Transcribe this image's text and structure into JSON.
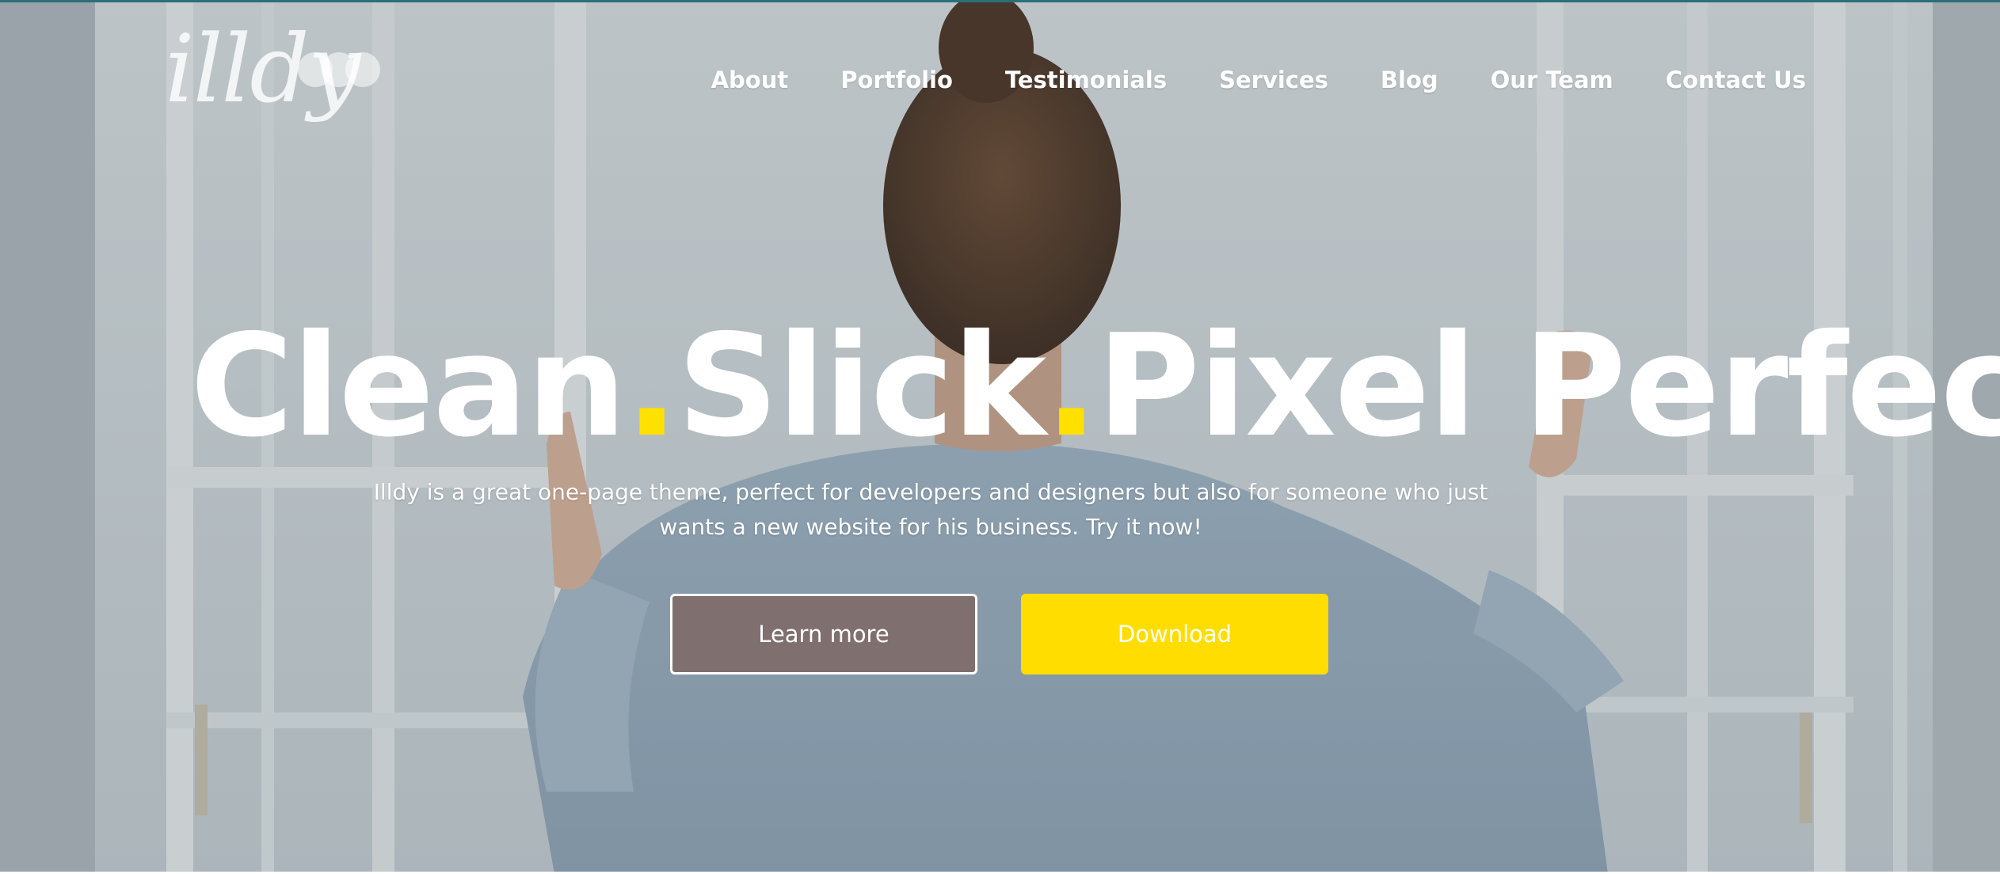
{
  "colors": {
    "accent": "#ffdd00",
    "learn_more_bg": "#7f6f6f",
    "text": "#ffffff",
    "top_stripe": "#2b6f78"
  },
  "logo": {
    "text": "illdy",
    "icon": "three-dots-logo-mark"
  },
  "nav": {
    "items": [
      {
        "label": "About"
      },
      {
        "label": "Portfolio"
      },
      {
        "label": "Testimonials"
      },
      {
        "label": "Services"
      },
      {
        "label": "Blog"
      },
      {
        "label": "Our Team"
      },
      {
        "label": "Contact Us"
      }
    ]
  },
  "hero": {
    "headline": {
      "word1": "Clean",
      "sep1": ".",
      "word2": "Slick",
      "sep2": ".",
      "word3": "Pixel Perfect"
    },
    "subtitle": "Illdy is a great one-page theme, perfect for developers and designers but also for someone who just wants a new website for his business. Try it now!",
    "buttons": {
      "learn_more": "Learn more",
      "download": "Download"
    }
  }
}
